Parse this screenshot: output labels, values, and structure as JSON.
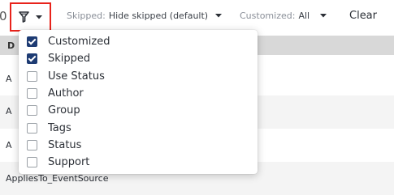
{
  "toolbar": {
    "filter_icon": "filter-funnel-icon",
    "skipped": {
      "label": "Skipped:",
      "value": "Hide skipped (default)"
    },
    "customized": {
      "label": "Customized:",
      "value": "All"
    },
    "clear_label": "Clear",
    "header_letter": "D",
    "left_glyph": "0"
  },
  "table": {
    "rows": [
      "A",
      "A",
      "A",
      "AppliesTo_EventSource"
    ]
  },
  "menu": {
    "options": [
      {
        "label": "Customized",
        "checked": true
      },
      {
        "label": "Skipped",
        "checked": true
      },
      {
        "label": "Use Status",
        "checked": false
      },
      {
        "label": "Author",
        "checked": false
      },
      {
        "label": "Group",
        "checked": false
      },
      {
        "label": "Tags",
        "checked": false
      },
      {
        "label": "Status",
        "checked": false
      },
      {
        "label": "Support",
        "checked": false
      }
    ]
  },
  "colors": {
    "accent": "#1d3b73",
    "highlight_border": "#e8231b"
  }
}
